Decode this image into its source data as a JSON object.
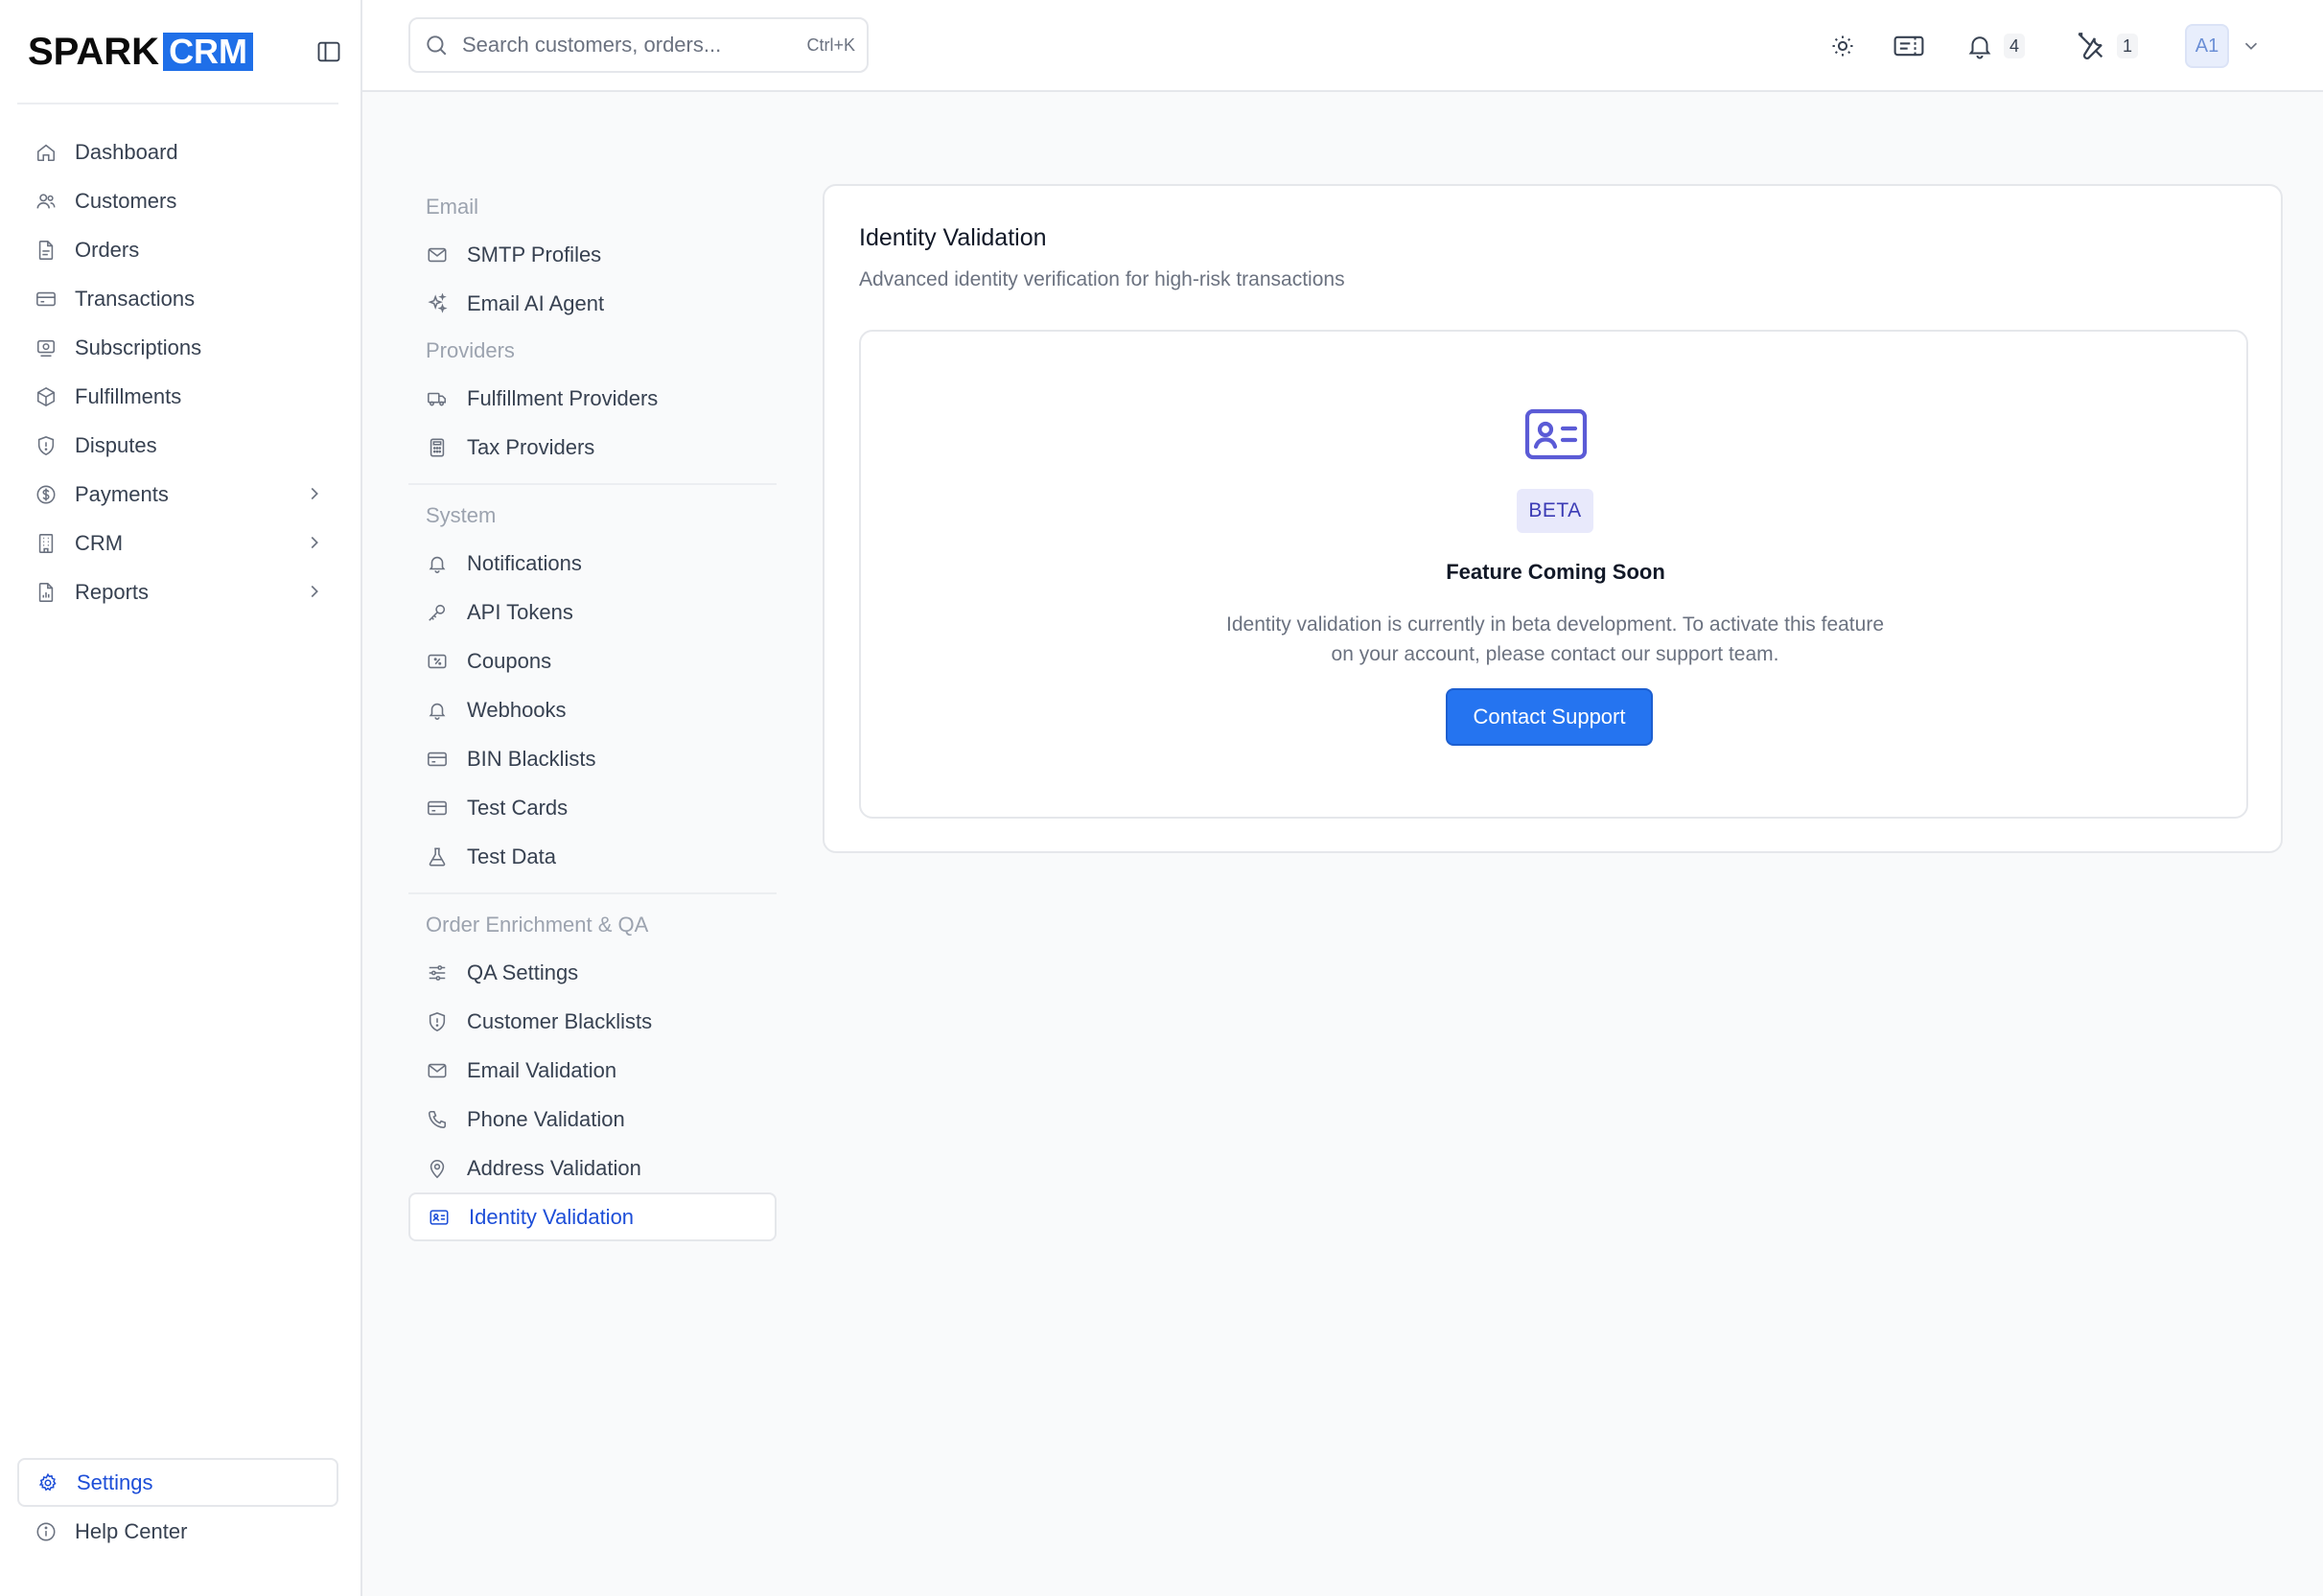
{
  "brand": {
    "spark": "SPARK",
    "crm": "CRM",
    "accent": "#1f6fe8"
  },
  "sidebar": {
    "items": [
      {
        "label": "Dashboard",
        "icon": "home-icon"
      },
      {
        "label": "Customers",
        "icon": "users-icon"
      },
      {
        "label": "Orders",
        "icon": "file-icon"
      },
      {
        "label": "Transactions",
        "icon": "credit-card-icon"
      },
      {
        "label": "Subscriptions",
        "icon": "subscription-icon"
      },
      {
        "label": "Fulfillments",
        "icon": "package-icon"
      },
      {
        "label": "Disputes",
        "icon": "shield-icon"
      },
      {
        "label": "Payments",
        "icon": "dollar-icon",
        "expandable": true
      },
      {
        "label": "CRM",
        "icon": "building-icon",
        "expandable": true
      },
      {
        "label": "Reports",
        "icon": "report-icon",
        "expandable": true
      }
    ],
    "bottom": [
      {
        "label": "Settings",
        "icon": "gear-icon",
        "active": true
      },
      {
        "label": "Help Center",
        "icon": "info-icon"
      }
    ]
  },
  "topbar": {
    "search_placeholder": "Search customers, orders...",
    "search_shortcut": "Ctrl+K",
    "notifications_count": "4",
    "tools_count": "1",
    "avatar_initials": "A1"
  },
  "settings_nav": {
    "email_heading": "Email",
    "smtp": "SMTP Profiles",
    "email_ai": "Email AI Agent",
    "providers_heading": "Providers",
    "fulfillment_providers": "Fulfillment Providers",
    "tax_providers": "Tax Providers",
    "system_heading": "System",
    "notifications": "Notifications",
    "api_tokens": "API Tokens",
    "coupons": "Coupons",
    "webhooks": "Webhooks",
    "bin_blacklists": "BIN Blacklists",
    "test_cards": "Test Cards",
    "test_data": "Test Data",
    "enrichment_heading": "Order Enrichment & QA",
    "qa_settings": "QA Settings",
    "customer_blacklists": "Customer Blacklists",
    "email_validation": "Email Validation",
    "phone_validation": "Phone Validation",
    "address_validation": "Address Validation",
    "identity_validation": "Identity Validation"
  },
  "main": {
    "title": "Identity Validation",
    "subtitle": "Advanced identity verification for high-risk transactions",
    "badge": "BETA",
    "heading": "Feature Coming Soon",
    "description": "Identity validation is currently in beta development. To activate this feature on your account, please contact our support team.",
    "button": "Contact Support"
  }
}
